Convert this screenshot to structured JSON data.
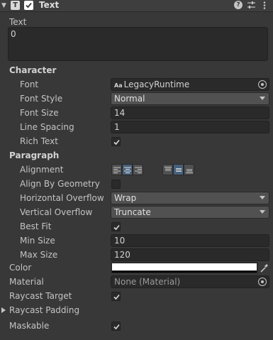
{
  "header": {
    "title": "Text"
  },
  "text_section": {
    "label": "Text",
    "value": "0"
  },
  "character": {
    "heading": "Character",
    "font_label": "Font",
    "font_value": "LegacyRuntime",
    "font_prefix": "Aa",
    "font_style_label": "Font Style",
    "font_style_value": "Normal",
    "font_size_label": "Font Size",
    "font_size_value": "14",
    "line_spacing_label": "Line Spacing",
    "line_spacing_value": "1",
    "rich_text_label": "Rich Text",
    "rich_text_checked": true
  },
  "paragraph": {
    "heading": "Paragraph",
    "alignment_label": "Alignment",
    "horizontal_selected": "center",
    "vertical_selected": "middle",
    "align_by_geometry_label": "Align By Geometry",
    "align_by_geometry_checked": false,
    "horizontal_overflow_label": "Horizontal Overflow",
    "horizontal_overflow_value": "Wrap",
    "vertical_overflow_label": "Vertical Overflow",
    "vertical_overflow_value": "Truncate",
    "best_fit_label": "Best Fit",
    "best_fit_checked": true,
    "min_size_label": "Min Size",
    "min_size_value": "10",
    "max_size_label": "Max Size",
    "max_size_value": "120"
  },
  "color": {
    "label": "Color",
    "value": "#ffffff"
  },
  "material": {
    "label": "Material",
    "value": "None (Material)"
  },
  "raycast_target": {
    "label": "Raycast Target",
    "checked": true
  },
  "raycast_padding": {
    "label": "Raycast Padding"
  },
  "maskable": {
    "label": "Maskable",
    "checked": true
  },
  "colors": {
    "bg": "#383838",
    "field": "#2a2a2a",
    "dropdown": "#515151",
    "selected": "#46607c",
    "text": "#c4c4c4"
  }
}
